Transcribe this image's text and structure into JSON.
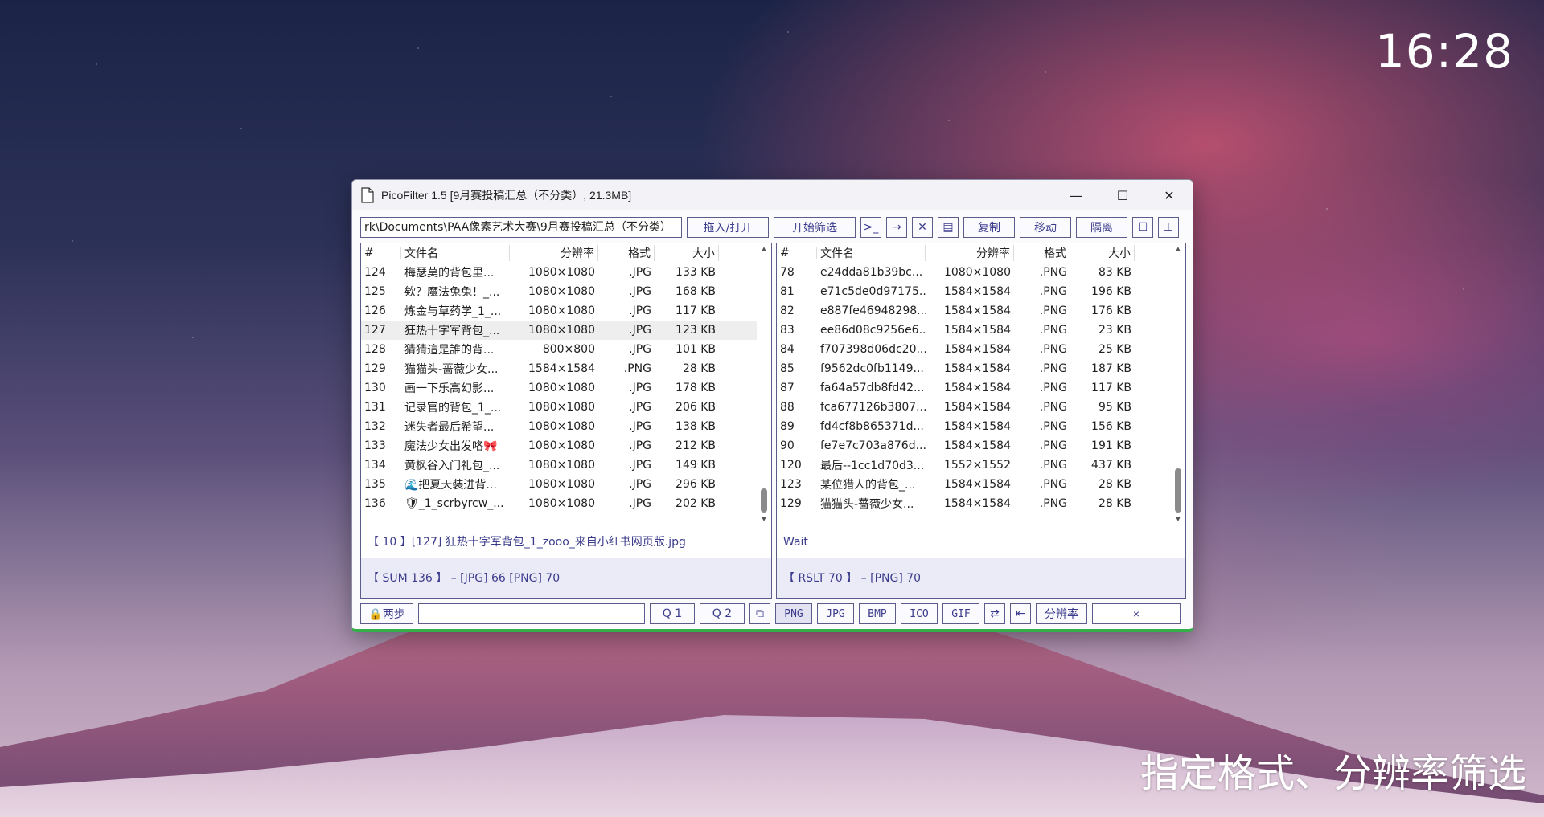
{
  "desktop": {
    "clock": "16:28",
    "caption": "指定格式、分辨率筛选"
  },
  "window": {
    "title": "PicoFilter 1.5  [9月赛投稿汇总（不分类）, 21.3MB]",
    "minimize_glyph": "—",
    "maximize_glyph": "☐",
    "close_glyph": "✕"
  },
  "toolbar": {
    "path": "rk\\Documents\\PAA像素艺术大赛\\9月赛投稿汇总（不分类）",
    "open_label": "拖入/打开",
    "start_label": "开始筛选",
    "terminal_glyph": ">_",
    "arrow_glyph": "→",
    "cross_glyph": "✕",
    "list_glyph": "▤",
    "copy_label": "复制",
    "move_label": "移动",
    "isolate_label": "隔离",
    "window_glyph": "☐",
    "pin_glyph": "⊥"
  },
  "left_panel": {
    "headers": [
      "#",
      "文件名",
      "分辨率",
      "格式",
      "大小"
    ],
    "rows": [
      [
        "124",
        "梅瑟莫的背包里...",
        "1080×1080",
        ".JPG",
        "133 KB"
      ],
      [
        "125",
        "欸？魔法兔兔！_...",
        "1080×1080",
        ".JPG",
        "168 KB"
      ],
      [
        "126",
        "炼金与草药学_1_...",
        "1080×1080",
        ".JPG",
        "117 KB"
      ],
      [
        "127",
        "狂热十字军背包_...",
        "1080×1080",
        ".JPG",
        "123 KB"
      ],
      [
        "128",
        "猜猜這是誰的背...",
        "800×800",
        ".JPG",
        "101 KB"
      ],
      [
        "129",
        "猫猫头-蔷薇少女...",
        "1584×1584",
        ".PNG",
        "28 KB"
      ],
      [
        "130",
        "画一下乐高幻影...",
        "1080×1080",
        ".JPG",
        "178 KB"
      ],
      [
        "131",
        "记录官的背包_1_...",
        "1080×1080",
        ".JPG",
        "206 KB"
      ],
      [
        "132",
        "迷失者最后希望...",
        "1080×1080",
        ".JPG",
        "138 KB"
      ],
      [
        "133",
        "魔法少女出发咯🎀",
        "1080×1080",
        ".JPG",
        "212 KB"
      ],
      [
        "134",
        "黄枫谷入门礼包_...",
        "1080×1080",
        ".JPG",
        "149 KB"
      ],
      [
        "135",
        "🌊把夏天装进背...",
        "1080×1080",
        ".JPG",
        "296 KB"
      ],
      [
        "136",
        "🛡_1_scrbyrcw_...",
        "1080×1080",
        ".JPG",
        "202 KB"
      ]
    ],
    "selected_rows": [
      3
    ],
    "status": "【 10 】[127]  狂热十字军背包_1_zooo_来自小红书网页版.jpg",
    "summary": "【 SUM 136 】 –  [JPG] 66  [PNG] 70"
  },
  "right_panel": {
    "headers": [
      "#",
      "文件名",
      "分辨率",
      "格式",
      "大小"
    ],
    "rows": [
      [
        "78",
        "e24dda81b39bc...",
        "1080×1080",
        ".PNG",
        "83 KB"
      ],
      [
        "81",
        "e71c5de0d97175...",
        "1584×1584",
        ".PNG",
        "196 KB"
      ],
      [
        "82",
        "e887fe46948298...",
        "1584×1584",
        ".PNG",
        "176 KB"
      ],
      [
        "83",
        "ee86d08c9256e6...",
        "1584×1584",
        ".PNG",
        "23 KB"
      ],
      [
        "84",
        "f707398d06dc20...",
        "1584×1584",
        ".PNG",
        "25 KB"
      ],
      [
        "85",
        "f9562dc0fb1149...",
        "1584×1584",
        ".PNG",
        "187 KB"
      ],
      [
        "87",
        "fa64a57db8fd42...",
        "1584×1584",
        ".PNG",
        "117 KB"
      ],
      [
        "88",
        "fca677126b3807...",
        "1584×1584",
        ".PNG",
        "95 KB"
      ],
      [
        "89",
        "fd4cf8b865371d...",
        "1584×1584",
        ".PNG",
        "156 KB"
      ],
      [
        "90",
        "fe7e7c703a876d...",
        "1584×1584",
        ".PNG",
        "191 KB"
      ],
      [
        "120",
        "最后--1cc1d70d3...",
        "1552×1552",
        ".PNG",
        "437 KB"
      ],
      [
        "123",
        "某位猎人的背包_...",
        "1584×1584",
        ".PNG",
        "28 KB"
      ],
      [
        "129",
        "猫猫头-蔷薇少女...",
        "1584×1584",
        ".PNG",
        "28 KB"
      ]
    ],
    "status": "Wait",
    "summary": "【 RSLT 70 】 –  [PNG] 70"
  },
  "bottombar": {
    "two_step_label": "🔒两步",
    "filter_value": "",
    "q1_label": "Q 1",
    "q2_label": "Q 2",
    "copy_glyph": "⧉",
    "formats": [
      "PNG",
      "JPG",
      "BMP",
      "ICO",
      "GIF"
    ],
    "active_format": "PNG",
    "swap_glyph": "⇄",
    "back_glyph": "⇤",
    "resolution_label": "分辨率",
    "clear_glyph": "×"
  },
  "colors": {
    "accent": "#3c3c8c",
    "border": "#5c5c8a",
    "progress": "#33b04a"
  }
}
